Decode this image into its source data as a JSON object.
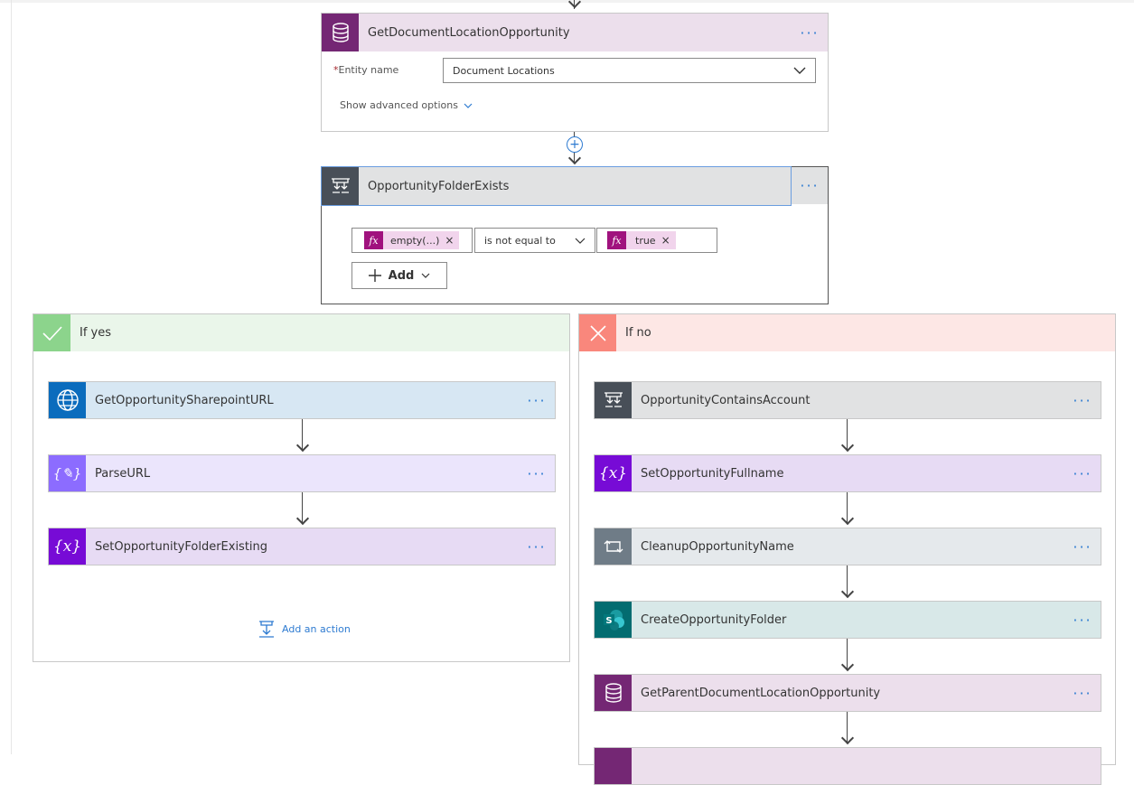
{
  "top_action": {
    "title": "GetDocumentLocationOpportunity",
    "icon": "database-icon",
    "color": "#742774",
    "header_bg": "#ecdfec",
    "entity_label": "Entity name",
    "entity_required_mark": "*",
    "entity_value": "Document Locations",
    "advanced_label": "Show advanced options"
  },
  "condition": {
    "title": "OpportunityFolderExists",
    "icon": "condition-icon",
    "color": "#484f58",
    "left_token": "empty(...)",
    "operator": "is not equal to",
    "right_token": "true",
    "fx_label": "fx",
    "add_label": "Add"
  },
  "if_yes": {
    "title": "If yes",
    "color": "#8cd48c",
    "actions": [
      {
        "title": "GetOpportunitySharepointURL",
        "icon": "globe-icon",
        "color": "#0b6cbd",
        "bg": "#d7e7f3"
      },
      {
        "title": "ParseURL",
        "icon": "compose-icon",
        "color": "#8c6cff",
        "bg": "#ebe5fc"
      },
      {
        "title": "SetOpportunityFolderExisting",
        "icon": "variable-icon",
        "color": "#770bd6",
        "bg": "#e7dbf4"
      }
    ],
    "add_action_label": "Add an action"
  },
  "if_no": {
    "title": "If no",
    "color": "#f9877c",
    "actions": [
      {
        "title": "OpportunityContainsAccount",
        "icon": "condition-icon",
        "color": "#484f58",
        "bg": "#e1e2e3"
      },
      {
        "title": "SetOpportunityFullname",
        "icon": "variable-icon",
        "color": "#770bd6",
        "bg": "#e7dbf4"
      },
      {
        "title": "CleanupOpportunityName",
        "icon": "loop-icon",
        "color": "#6f7c87",
        "bg": "#e5e9ec"
      },
      {
        "title": "CreateOpportunityFolder",
        "icon": "sharepoint-icon",
        "color": "#036c70",
        "bg": "#d8e8e8"
      },
      {
        "title": "GetParentDocumentLocationOpportunity",
        "icon": "database-icon",
        "color": "#742774",
        "bg": "#ecdfec"
      }
    ]
  },
  "more_label": "···"
}
